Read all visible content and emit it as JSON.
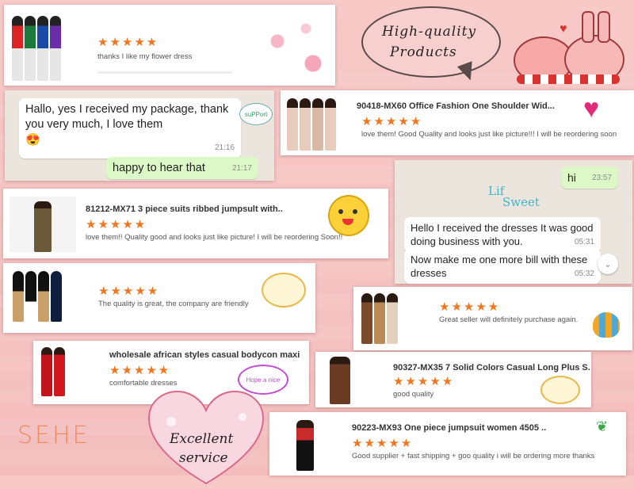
{
  "header_bubble": {
    "line1": "High-quality",
    "line2": "Products"
  },
  "cards": {
    "c1": {
      "stars": "★★★★★",
      "review": "thanks I like my flower dress"
    },
    "c2": {
      "title": "90418-MX60 Office Fashion One Shoulder Wid...",
      "stars": "★★★★★",
      "review": "love them! Good Quality and looks just like picture!!! I will be reordering soon"
    },
    "c3": {
      "title": "81212-MX71 3 piece suits ribbed jumpsult with..",
      "stars": "★★★★★",
      "review": "love them!! Quality good and looks just like picture! I will be reordering Soon!!"
    },
    "c4": {
      "stars": "★★★★★",
      "review": "The quality is great, the company are friendly"
    },
    "c5": {
      "stars": "★★★★★",
      "review": "Great seller will definitely purchase again."
    },
    "c6": {
      "title": "wholesale african styles casual bodycon maxi d..",
      "stars": "★★★★★",
      "review": "comfortable dresses"
    },
    "c7": {
      "title": "90327-MX35 7 Solid Colors Casual Long Plus S..",
      "stars": "★★★★★",
      "review": "good quality"
    },
    "c8": {
      "title": "90223-MX93 One piece jumpsuit women 4505 ..",
      "stars": "★★★★★",
      "review": "Good supplier + fast shipping + goo quality i will be ordering more thanks"
    }
  },
  "chat1": {
    "in_text": "Hallo, yes I received my package, thank you very much, I love them",
    "in_emoji": "😍",
    "in_time": "21:16",
    "out_text": "happy to hear that",
    "out_time": "21:17",
    "sticker": "suPPort"
  },
  "chat2": {
    "out_text": "hi",
    "out_time": "23:57",
    "sticker1": "Lif",
    "sticker2": "Sweet",
    "in1_text": "Hello I received the dresses It was good doing business with you.",
    "in1_time": "05:31",
    "in2_text": "Now make me one more bill with these dresses",
    "in2_time": "05:32"
  },
  "stickers": {
    "s1": "Hope a nice"
  },
  "brand": "SEHE",
  "heart_text": {
    "line1": "Excellent",
    "line2": "service"
  },
  "colors": {
    "star": "#f2761f",
    "background": "#f5c3c2",
    "chat_bg": "#ece5dd",
    "out_bubble": "#dcf8c6",
    "brand": "#f08a5d"
  }
}
